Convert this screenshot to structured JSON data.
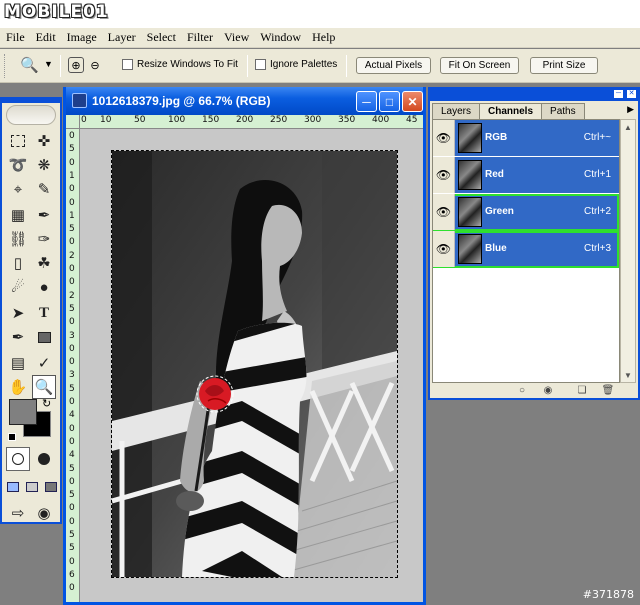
{
  "site_logo": "MOBILE01",
  "menu": [
    "File",
    "Edit",
    "Image",
    "Layer",
    "Select",
    "Filter",
    "View",
    "Window",
    "Help"
  ],
  "options": {
    "resize_windows": "Resize Windows To Fit",
    "ignore_palettes": "Ignore Palettes",
    "actual_pixels": "Actual Pixels",
    "fit_on_screen": "Fit On Screen",
    "print_size": "Print Size"
  },
  "document": {
    "title": "1012618379.jpg @ 66.7% (RGB)",
    "ruler_h": [
      "0",
      "10",
      "50",
      "100",
      "150",
      "200",
      "250",
      "300",
      "350",
      "400",
      "45"
    ],
    "ruler_v": [
      "0",
      "5",
      "0",
      "1",
      "0",
      "0",
      "1",
      "5",
      "0",
      "2",
      "0",
      "0",
      "2",
      "5",
      "0",
      "3",
      "0",
      "0",
      "3",
      "5",
      "0",
      "4",
      "0",
      "0",
      "4",
      "5",
      "0",
      "5",
      "0",
      "0",
      "5",
      "5",
      "0",
      "6",
      "0"
    ]
  },
  "panel": {
    "tabs": [
      "Layers",
      "Channels",
      "Paths"
    ],
    "active_tab": "Channels",
    "channels": [
      {
        "name": "RGB",
        "shortcut": "Ctrl+~",
        "visible": true
      },
      {
        "name": "Red",
        "shortcut": "Ctrl+1",
        "visible": true
      },
      {
        "name": "Green",
        "shortcut": "Ctrl+2",
        "visible": true
      },
      {
        "name": "Blue",
        "shortcut": "Ctrl+3",
        "visible": true
      }
    ]
  },
  "colors": {
    "foreground": "#808080",
    "background": "#000000",
    "accent": "#3169c6",
    "highlight": "#2ee02e",
    "rose": "#d81a24"
  },
  "watermark": "#371878"
}
